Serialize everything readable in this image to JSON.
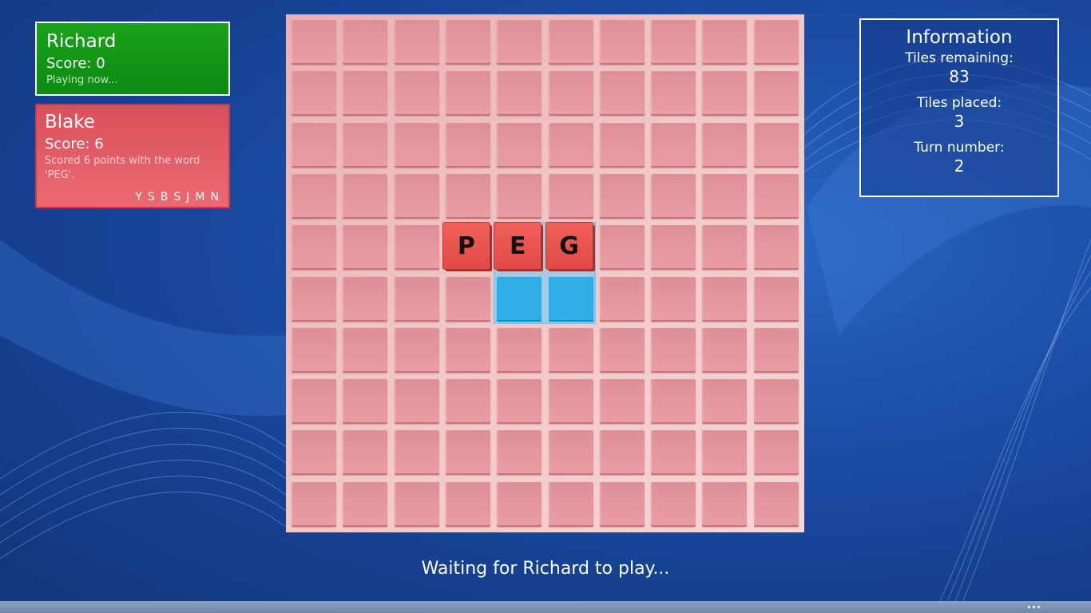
{
  "players": [
    {
      "name": "Richard",
      "score": "Score: 0",
      "status": "Playing now...",
      "active": true
    },
    {
      "name": "Blake",
      "score": "Score: 6",
      "status": "Scored 6 points with the word 'PEG'.",
      "rack": [
        "Y",
        "S",
        "B",
        "S",
        "J",
        "M",
        "N"
      ],
      "active": false
    }
  ],
  "info": {
    "title": "Information",
    "tiles_remaining_label": "Tiles remaining:",
    "tiles_remaining": "83",
    "tiles_placed_label": "Tiles placed:",
    "tiles_placed": "3",
    "turn_number_label": "Turn number:",
    "turn_number": "2"
  },
  "board": {
    "rows": 10,
    "cols": 10,
    "placed_tiles": [
      {
        "row": 4,
        "col": 3,
        "letter": "P"
      },
      {
        "row": 4,
        "col": 4,
        "letter": "E"
      },
      {
        "row": 4,
        "col": 5,
        "letter": "G"
      }
    ],
    "highlighted_cells": [
      {
        "row": 5,
        "col": 4
      },
      {
        "row": 5,
        "col": 5
      }
    ]
  },
  "status_text": "Waiting for Richard to play...",
  "colors": {
    "active_player": "#109615",
    "inactive_player": "#e35f69",
    "tile": "#e9534d",
    "highlight": "#2faee6",
    "background": "#1c4fa8"
  }
}
